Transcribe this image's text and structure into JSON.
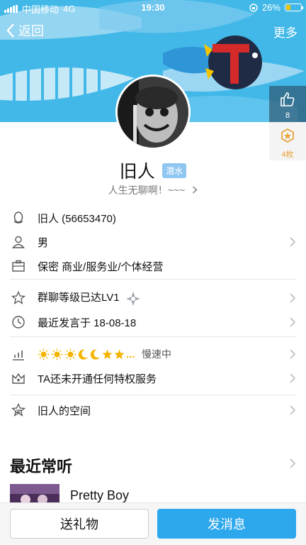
{
  "status_bar": {
    "carrier": "中国移动",
    "network": "4G",
    "time": "19:30",
    "battery": "26%"
  },
  "nav": {
    "back_label": "返回",
    "more_label": "更多"
  },
  "likes": {
    "count": "8"
  },
  "medals": {
    "count": "4枚"
  },
  "profile": {
    "name": "旧人",
    "badge": "潜水",
    "signature": "人生无聊啊！~~~"
  },
  "info": {
    "qq": "旧人 (56653470)",
    "gender": "男",
    "job": "保密 商业/服务业/个体经营"
  },
  "activity": {
    "group_level": "群聊等级已达LV1",
    "last_speak": "最近发言于 18-08-18"
  },
  "level": {
    "speed": "慢速中",
    "level_icons": [
      "sun-icon",
      "sun-icon",
      "sun-icon",
      "moon-icon",
      "moon-icon",
      "star-icon",
      "star-icon"
    ],
    "ellipsis": "..."
  },
  "privilege": {
    "text": "TA还未开通任何特权服务"
  },
  "space": {
    "text": "旧人的空间"
  },
  "recent_music": {
    "title": "最近常听",
    "song": "Pretty Boy"
  },
  "actions": {
    "gift": "送礼物",
    "message": "发消息"
  },
  "colors": {
    "cover_bg": "#41b8e8",
    "accent": "#2ea8ec",
    "badge": "#8ec6f0",
    "medal": "#e8a23a"
  }
}
